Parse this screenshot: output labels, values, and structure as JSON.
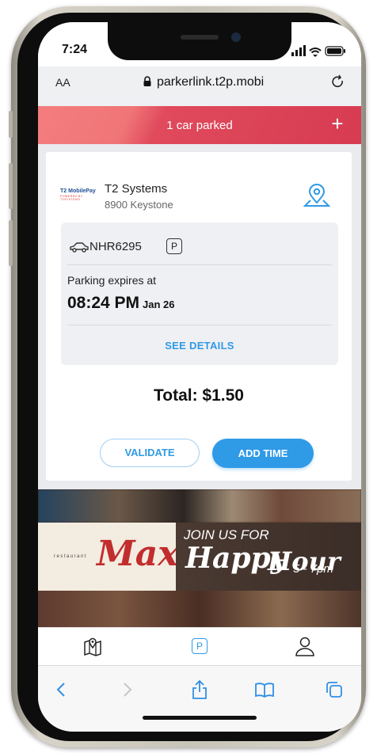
{
  "status_bar": {
    "time": "7:24"
  },
  "browser": {
    "text_size_label": "AA",
    "url": "parkerlink.t2p.mobi"
  },
  "banner": {
    "text": "1 car parked",
    "add_label": "+"
  },
  "card": {
    "logo": {
      "line1": "T2 MobilePay",
      "line2": "POWERED BY T2SYSTEMS"
    },
    "operator_name": "T2 Systems",
    "address": "8900 Keystone",
    "plate": "NHR6295",
    "permit_badge": "P",
    "expires_label": "Parking expires at",
    "expires_time": "08:24 PM",
    "expires_date": "Jan 26",
    "details_link": "SEE DETAILS",
    "total": "Total: $1.50",
    "validate_label": "VALIDATE",
    "add_time_label": "ADD TIME"
  },
  "ad": {
    "restaurant_label": "restaurant",
    "brand": "Max",
    "join_text": "JOIN US FOR",
    "happy_text": "Happy",
    "hour_text": "Hour",
    "times": "5 - 7pm"
  },
  "tabs": [
    {
      "name": "map",
      "icon": "map-icon"
    },
    {
      "name": "parking",
      "icon": "parking-icon",
      "label": "P"
    },
    {
      "name": "profile",
      "icon": "profile-icon"
    }
  ],
  "colors": {
    "accent": "#2f9ae6",
    "banner": "#e04a5c"
  }
}
